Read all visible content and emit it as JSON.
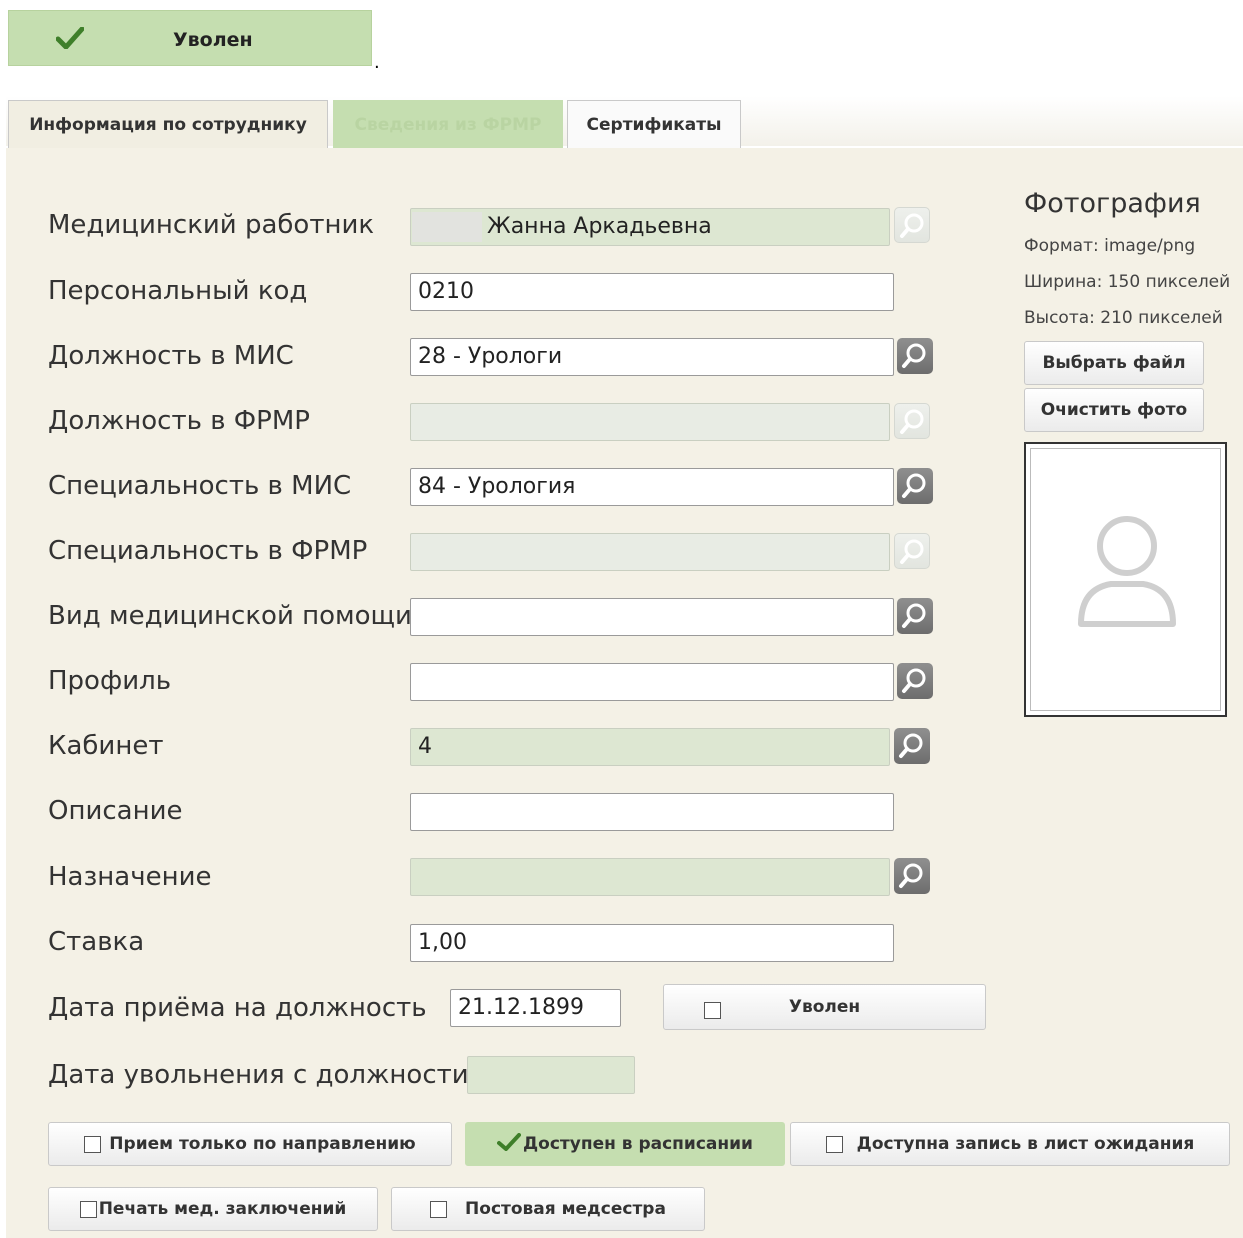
{
  "status_button": {
    "label": "Уволен",
    "icon": "checkmark-icon"
  },
  "tabs": [
    {
      "label": "Информация по сотруднику"
    },
    {
      "label": "Сведения из ФРМР"
    },
    {
      "label": "Сертификаты"
    }
  ],
  "form": {
    "worker": {
      "label": "Медицинский работник",
      "value": "Жанна Аркадьевна"
    },
    "personal_code": {
      "label": "Персональный код",
      "value": "0210"
    },
    "position_mis": {
      "label": "Должность в МИС",
      "value": "28 - Урологи"
    },
    "position_frmr": {
      "label": "Должность в ФРМР",
      "value": ""
    },
    "specialty_mis": {
      "label": "Специальность в МИС",
      "value": "84 - Урология"
    },
    "specialty_frmr": {
      "label": "Специальность в ФРМР",
      "value": ""
    },
    "care_type": {
      "label": "Вид медицинской помощи",
      "value": ""
    },
    "profile": {
      "label": "Профиль",
      "value": ""
    },
    "cabinet": {
      "label": "Кабинет",
      "value": "4"
    },
    "description": {
      "label": "Описание",
      "value": ""
    },
    "assignment": {
      "label": "Назначение",
      "value": ""
    },
    "rate": {
      "label": "Ставка",
      "value": "1,00"
    },
    "hire_date": {
      "label": "Дата приёма на должность",
      "value": "21.12.1899"
    },
    "dismiss_date": {
      "label": "Дата увольнения с должности",
      "value": ""
    },
    "dismissed_toggle": {
      "label": "Уволен",
      "checked": false
    }
  },
  "photo": {
    "title": "Фотография",
    "format": "Формат: image/png",
    "width": "Ширина: 150 пикселей",
    "height": "Высота: 210 пикселей",
    "choose_label": "Выбрать файл",
    "clear_label": "Очистить фото"
  },
  "toggles": {
    "referral_only": {
      "label": "Прием только по направлению",
      "checked": false
    },
    "in_schedule": {
      "label": "Доступен в расписании",
      "checked": true
    },
    "waiting_list": {
      "label": "Доступна запись в лист ожидания",
      "checked": false
    },
    "print_conclusions": {
      "label": "Печать мед. заключений",
      "checked": false
    },
    "ward_nurse": {
      "label": "Постовая медсестра",
      "checked": false
    }
  },
  "colors": {
    "accent_green": "#c5deb0",
    "panel_bg": "#f4f1e6",
    "readonly_field": "#dde7d2"
  }
}
